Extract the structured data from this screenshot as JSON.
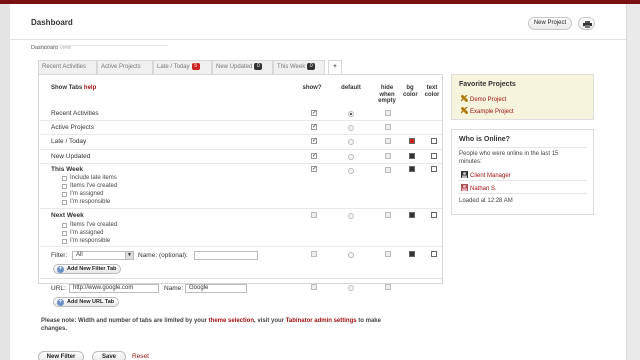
{
  "header": {
    "title": "Dashboard",
    "new_project": "New Project"
  },
  "breadcrumb": {
    "parent": "Dashboard",
    "current": "View"
  },
  "tabs": [
    {
      "label": "Recent Activities"
    },
    {
      "label": "Active Projects"
    },
    {
      "label": "Late / Today",
      "badge": "5",
      "badge_color": "#cc2222"
    },
    {
      "label": "New Updated",
      "badge": "0",
      "badge_color": "#333333"
    },
    {
      "label": "This Week",
      "badge": "0",
      "badge_color": "#333333"
    },
    {
      "label": "+"
    }
  ],
  "table": {
    "title": "Show Tabs",
    "help": "help",
    "columns": {
      "show": "show?",
      "default": "default",
      "hide": "hide when empty",
      "bg": "bg color",
      "text": "text color"
    },
    "rows": [
      {
        "label": "Recent Activities",
        "show": true,
        "default": true,
        "hide": false,
        "bg": "",
        "text": ""
      },
      {
        "label": "Active Projects",
        "show": true,
        "default": false,
        "hide": false,
        "bg": "",
        "text": ""
      },
      {
        "label": "Late / Today",
        "show": true,
        "default": false,
        "hide": false,
        "bg": "#cc2222",
        "text": "#ffffff"
      },
      {
        "label": "New Updated",
        "show": true,
        "default": false,
        "hide": false,
        "bg": "#333333",
        "text": "#ffffff"
      },
      {
        "label": "This Week",
        "show": true,
        "default": false,
        "hide": false,
        "bg": "#333333",
        "text": "#ffffff",
        "options": [
          "Include late items",
          "Items I've created",
          "I'm assigned",
          "I'm responsible"
        ]
      },
      {
        "label": "Next Week",
        "show": false,
        "default": false,
        "hide": false,
        "bg": "#333333",
        "text": "#ffffff",
        "options": [
          "Items I've created",
          "I'm assigned",
          "I'm responsible"
        ]
      }
    ],
    "filter": {
      "label": "Filter:",
      "value": "All",
      "name_label": "Name: (optional):",
      "name_value": "",
      "add_button": "Add New Filter Tab"
    },
    "url": {
      "label": "URL:",
      "value": "http://www.google.com",
      "name_label": "Name:",
      "name_value": "Google",
      "add_button": "Add New URL Tab"
    }
  },
  "note": {
    "prefix": "Please note: Width and number of tabs are limited by your",
    "link1": "theme selection",
    "middle": ", visit your",
    "link2": "Tabinator admin settings",
    "suffix": "to make changes."
  },
  "footer": {
    "new_filter": "New Filter",
    "save": "Save",
    "reset": "Reset"
  },
  "favorites": {
    "title": "Favorite Projects",
    "items": [
      "Demo Project",
      "Example Project"
    ]
  },
  "online": {
    "title": "Who is Online?",
    "description": "People who were online in the last 15 minutes:",
    "users": [
      "Client Manager",
      "Nathan S."
    ],
    "loaded": "Loaded at 12:28 AM"
  }
}
